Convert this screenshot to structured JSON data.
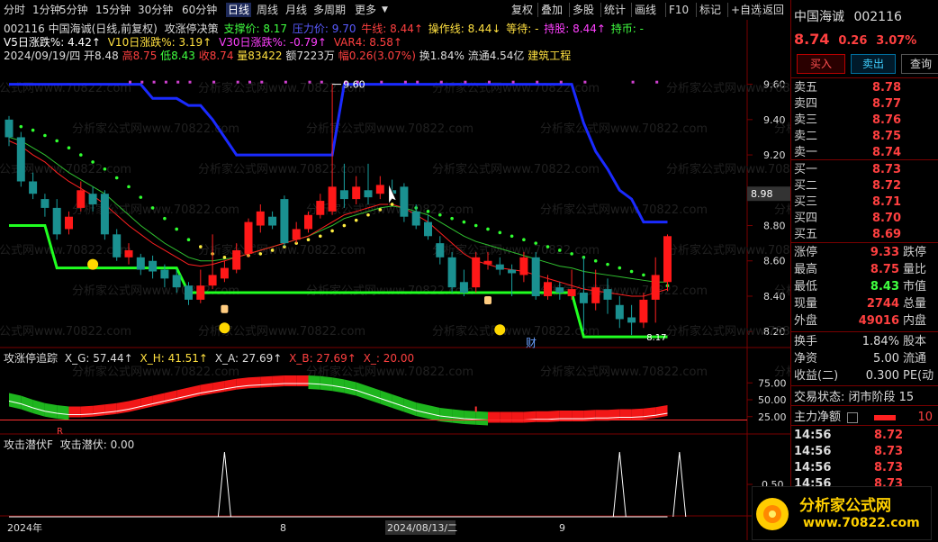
{
  "topbar": {
    "periods": [
      "分时",
      "1分钟",
      "5分钟",
      "15分钟",
      "30分钟",
      "60分钟",
      "日线",
      "周线",
      "月线",
      "多周期",
      "更多"
    ],
    "active_period": "日线",
    "actions": [
      "复权",
      "叠加",
      "多股",
      "统计",
      "画线",
      "F10",
      "标记",
      "+自选",
      "返回"
    ]
  },
  "header": {
    "code_name": "002116 中国海诚(日线,前复权)",
    "indicator_name": "攻涨停决策",
    "support_label": "支撑价: 8.17",
    "pressure_label": "压力价: 9.70",
    "bull_label": "牛线: 8.44↑",
    "op_label": "操作线: 8.44↓",
    "wait_label": "等待: -",
    "hold_label": "持股: 8.44↑",
    "hold_coin_label": "持币: -",
    "v5_label": "V5日涨跌%: 4.42↑",
    "v10_label": "V10日涨跌%: 3.19↑",
    "v30_label": "V30日涨跌%: -0.79↑",
    "var4_label": "VAR4: 8.58↑",
    "info_date": "2024/09/19/四",
    "info_open": "开8.48",
    "info_high": "高8.75",
    "info_low": "低8.43",
    "info_close": "收8.74",
    "info_vol": "量83422",
    "info_amt": "额7223万",
    "info_pct": "幅0.26(3.07%)",
    "info_turn": "换1.84%",
    "info_float": "流通4.54亿",
    "info_sector": "建筑工程"
  },
  "main_axis": {
    "ticks": [
      "9.60",
      "9.40",
      "9.20",
      "9.00",
      "8.80",
      "8.60",
      "8.40",
      "8.20"
    ],
    "current_label": "8.98",
    "max_label": "9.60",
    "min_label": "8.17"
  },
  "sub1": {
    "title": "攻涨停追踪",
    "xg": "X_G: 57.44↑",
    "xh": "X_H: 41.51↑",
    "xa": "X_A: 27.69↑",
    "xb": "X_B: 27.69↑",
    "xx": "X_: 20.00",
    "ticks": [
      "75.00",
      "50.00",
      "25.00"
    ]
  },
  "sub2": {
    "title": "攻击潜伏F",
    "value_label": "攻击潜伏: 0.00",
    "tick": "0.50"
  },
  "xaxis": {
    "labels": [
      "2024年",
      "8",
      "2024/08/13/二",
      "9"
    ]
  },
  "markers": {
    "cai": "财",
    "r_mark": "R"
  },
  "watermark": "分析家公式网www.70822.com",
  "right": {
    "name": "中国海诚",
    "code": "002116",
    "price": "8.74",
    "change": "0.26",
    "pct": "3.07%",
    "buy_btn": "买入",
    "sell_btn": "卖出",
    "query_btn": "查询",
    "asks": [
      {
        "label": "卖五",
        "price": "8.78"
      },
      {
        "label": "卖四",
        "price": "8.77"
      },
      {
        "label": "卖三",
        "price": "8.76"
      },
      {
        "label": "卖二",
        "price": "8.75"
      },
      {
        "label": "卖一",
        "price": "8.74"
      }
    ],
    "bids": [
      {
        "label": "买一",
        "price": "8.73"
      },
      {
        "label": "买二",
        "price": "8.72"
      },
      {
        "label": "买三",
        "price": "8.71"
      },
      {
        "label": "买四",
        "price": "8.70"
      },
      {
        "label": "买五",
        "price": "8.69"
      }
    ],
    "stats": [
      {
        "k": "涨停",
        "v": "9.33",
        "k2": "跌停"
      },
      {
        "k": "最高",
        "v": "8.75",
        "k2": "量比"
      },
      {
        "k": "最低",
        "v": "8.43",
        "k2": "市值"
      },
      {
        "k": "现量",
        "v": "2744",
        "k2": "总量"
      },
      {
        "k": "外盘",
        "v": "49016",
        "k2": "内盘"
      }
    ],
    "stats2": [
      {
        "k": "换手",
        "v": "1.84%",
        "k2": "股本"
      },
      {
        "k": "净资",
        "v": "5.00",
        "k2": "流通"
      },
      {
        "k": "收益(二)",
        "v": "0.300",
        "k2": "PE(动"
      }
    ],
    "trade_state": "交易状态: 闭市阶段 15",
    "main_net": "主力净额",
    "main_net_val": "10",
    "ticks": [
      {
        "t": "14:56",
        "p": "8.72"
      },
      {
        "t": "14:56",
        "p": "8.73"
      },
      {
        "t": "14:56",
        "p": "8.73"
      },
      {
        "t": "14:56",
        "p": "8.73"
      }
    ]
  },
  "logo": {
    "title": "分析家公式网",
    "url": "www.70822.com"
  },
  "chart_data": {
    "type": "candlestick",
    "ylim": [
      8.15,
      9.7
    ],
    "candles": [
      {
        "o": 9.4,
        "c": 9.3,
        "h": 9.42,
        "l": 9.25
      },
      {
        "o": 9.3,
        "c": 9.05,
        "h": 9.33,
        "l": 9.02
      },
      {
        "o": 9.05,
        "c": 8.98,
        "h": 9.1,
        "l": 8.95
      },
      {
        "o": 8.95,
        "c": 8.9,
        "h": 8.98,
        "l": 8.85
      },
      {
        "o": 8.9,
        "c": 8.75,
        "h": 8.95,
        "l": 8.72
      },
      {
        "o": 8.78,
        "c": 8.85,
        "h": 8.88,
        "l": 8.75
      },
      {
        "o": 8.9,
        "c": 9.0,
        "h": 9.05,
        "l": 8.88
      },
      {
        "o": 8.98,
        "c": 8.92,
        "h": 9.02,
        "l": 8.88
      },
      {
        "o": 8.98,
        "c": 8.75,
        "h": 9.0,
        "l": 8.72
      },
      {
        "o": 8.75,
        "c": 8.62,
        "h": 8.78,
        "l": 8.6
      },
      {
        "o": 8.62,
        "c": 8.66,
        "h": 8.7,
        "l": 8.58
      },
      {
        "o": 8.62,
        "c": 8.55,
        "h": 8.64,
        "l": 8.52
      },
      {
        "o": 8.6,
        "c": 8.54,
        "h": 8.63,
        "l": 8.5
      },
      {
        "o": 8.55,
        "c": 8.5,
        "h": 8.58,
        "l": 8.45
      },
      {
        "o": 8.52,
        "c": 8.45,
        "h": 8.55,
        "l": 8.42
      },
      {
        "o": 8.46,
        "c": 8.38,
        "h": 8.48,
        "l": 8.35
      },
      {
        "o": 8.38,
        "c": 8.46,
        "h": 8.55,
        "l": 8.36
      },
      {
        "o": 8.46,
        "c": 8.52,
        "h": 8.75,
        "l": 8.44
      },
      {
        "o": 8.5,
        "c": 8.56,
        "h": 8.6,
        "l": 8.48
      },
      {
        "o": 8.55,
        "c": 8.66,
        "h": 8.7,
        "l": 8.53
      },
      {
        "o": 8.64,
        "c": 8.82,
        "h": 8.84,
        "l": 8.62
      },
      {
        "o": 8.8,
        "c": 8.88,
        "h": 8.92,
        "l": 8.76
      },
      {
        "o": 8.85,
        "c": 8.8,
        "h": 8.88,
        "l": 8.78
      },
      {
        "o": 8.95,
        "c": 8.7,
        "h": 8.97,
        "l": 8.68
      },
      {
        "o": 8.72,
        "c": 8.78,
        "h": 8.82,
        "l": 8.7
      },
      {
        "o": 8.78,
        "c": 8.86,
        "h": 8.88,
        "l": 8.76
      },
      {
        "o": 8.86,
        "c": 8.94,
        "h": 8.98,
        "l": 8.84
      },
      {
        "o": 8.88,
        "c": 9.02,
        "h": 9.6,
        "l": 8.86
      },
      {
        "o": 9.0,
        "c": 8.95,
        "h": 9.15,
        "l": 8.9
      },
      {
        "o": 8.95,
        "c": 9.02,
        "h": 9.08,
        "l": 8.92
      },
      {
        "o": 9.0,
        "c": 8.96,
        "h": 9.15,
        "l": 8.92
      },
      {
        "o": 8.98,
        "c": 9.03,
        "h": 9.08,
        "l": 8.95
      },
      {
        "o": 9.0,
        "c": 8.98,
        "h": 9.06,
        "l": 8.95
      },
      {
        "o": 9.02,
        "c": 8.85,
        "h": 9.04,
        "l": 8.82
      },
      {
        "o": 8.88,
        "c": 8.8,
        "h": 8.92,
        "l": 8.78
      },
      {
        "o": 8.82,
        "c": 8.74,
        "h": 8.86,
        "l": 8.72
      },
      {
        "o": 8.7,
        "c": 8.62,
        "h": 8.74,
        "l": 8.58
      },
      {
        "o": 8.62,
        "c": 8.45,
        "h": 8.65,
        "l": 8.42
      },
      {
        "o": 8.48,
        "c": 8.42,
        "h": 8.55,
        "l": 8.4
      },
      {
        "o": 8.45,
        "c": 8.62,
        "h": 8.65,
        "l": 8.42
      },
      {
        "o": 8.58,
        "c": 8.6,
        "h": 8.65,
        "l": 8.55
      },
      {
        "o": 8.58,
        "c": 8.55,
        "h": 8.62,
        "l": 8.52
      },
      {
        "o": 8.55,
        "c": 8.53,
        "h": 8.58,
        "l": 8.4
      },
      {
        "o": 8.52,
        "c": 8.62,
        "h": 8.65,
        "l": 8.48
      },
      {
        "o": 8.62,
        "c": 8.4,
        "h": 8.65,
        "l": 8.38
      },
      {
        "o": 8.4,
        "c": 8.48,
        "h": 8.52,
        "l": 8.38
      },
      {
        "o": 8.45,
        "c": 8.42,
        "h": 8.48,
        "l": 8.38
      },
      {
        "o": 8.4,
        "c": 8.44,
        "h": 8.55,
        "l": 8.38
      },
      {
        "o": 8.42,
        "c": 8.36,
        "h": 8.62,
        "l": 8.2
      },
      {
        "o": 8.36,
        "c": 8.45,
        "h": 8.55,
        "l": 8.32
      },
      {
        "o": 8.44,
        "c": 8.38,
        "h": 8.5,
        "l": 8.3
      },
      {
        "o": 8.35,
        "c": 8.27,
        "h": 8.4,
        "l": 8.22
      },
      {
        "o": 8.28,
        "c": 8.25,
        "h": 8.35,
        "l": 8.18
      },
      {
        "o": 8.25,
        "c": 8.38,
        "h": 8.42,
        "l": 8.22
      },
      {
        "o": 8.38,
        "c": 8.52,
        "h": 8.62,
        "l": 8.25
      },
      {
        "o": 8.48,
        "c": 8.74,
        "h": 8.75,
        "l": 8.43
      }
    ],
    "support_line": [
      8.8,
      8.8,
      8.8,
      8.8,
      8.56,
      8.56,
      8.56,
      8.56,
      8.56,
      8.56,
      8.56,
      8.56,
      8.56,
      8.56,
      8.56,
      8.42,
      8.42,
      8.42,
      8.42,
      8.42,
      8.42,
      8.42,
      8.42,
      8.42,
      8.42,
      8.42,
      8.42,
      8.42,
      8.42,
      8.42,
      8.42,
      8.42,
      8.42,
      8.42,
      8.42,
      8.42,
      8.42,
      8.42,
      8.42,
      8.42,
      8.42,
      8.42,
      8.42,
      8.42,
      8.42,
      8.42,
      8.42,
      8.42,
      8.17,
      8.17,
      8.17,
      8.17,
      8.17,
      8.17,
      8.17,
      8.17
    ],
    "pressure_line": [
      9.6,
      9.6,
      9.6,
      9.6,
      9.6,
      9.6,
      9.6,
      9.6,
      9.6,
      9.6,
      9.6,
      9.6,
      9.52,
      9.52,
      9.52,
      9.48,
      9.48,
      9.4,
      9.3,
      9.2,
      9.2,
      9.2,
      9.2,
      9.2,
      9.2,
      9.2,
      9.2,
      9.2,
      9.6,
      9.6,
      9.6,
      9.6,
      9.6,
      9.6,
      9.6,
      9.6,
      9.6,
      9.6,
      9.6,
      9.6,
      9.6,
      9.6,
      9.6,
      9.6,
      9.6,
      9.6,
      9.6,
      9.6,
      9.38,
      9.22,
      9.12,
      9.0,
      8.95,
      8.82,
      8.82,
      8.82
    ],
    "ma_red": [
      9.28,
      9.25,
      9.2,
      9.16,
      9.1,
      9.05,
      9.01,
      8.97,
      8.92,
      8.86,
      8.8,
      8.75,
      8.7,
      8.66,
      8.62,
      8.58,
      8.57,
      8.58,
      8.6,
      8.62,
      8.64,
      8.66,
      8.68,
      8.7,
      8.72,
      8.74,
      8.78,
      8.82,
      8.86,
      8.88,
      8.9,
      8.92,
      8.92,
      8.9,
      8.86,
      8.82,
      8.76,
      8.7,
      8.64,
      8.6,
      8.58,
      8.56,
      8.55,
      8.54,
      8.52,
      8.5,
      8.48,
      8.46,
      8.44,
      8.43,
      8.42,
      8.41,
      8.4,
      8.4,
      8.42,
      8.44
    ],
    "ma_green": [
      9.3,
      9.28,
      9.24,
      9.2,
      9.15,
      9.1,
      9.06,
      9.02,
      8.98,
      8.92,
      8.86,
      8.8,
      8.75,
      8.7,
      8.66,
      8.62,
      8.6,
      8.6,
      8.61,
      8.62,
      8.64,
      8.66,
      8.68,
      8.7,
      8.72,
      8.74,
      8.77,
      8.8,
      8.84,
      8.86,
      8.88,
      8.9,
      8.91,
      8.9,
      8.88,
      8.86,
      8.82,
      8.78,
      8.74,
      8.71,
      8.69,
      8.67,
      8.65,
      8.63,
      8.61,
      8.59,
      8.57,
      8.56,
      8.54,
      8.53,
      8.52,
      8.51,
      8.5,
      8.49,
      8.48,
      8.48
    ],
    "dots": [
      9.38,
      9.36,
      9.34,
      9.31,
      9.28,
      9.24,
      9.2,
      9.16,
      9.12,
      9.07,
      9.02,
      8.96,
      8.9,
      8.84,
      8.78,
      8.72,
      8.68,
      8.64,
      8.62,
      8.62,
      8.63,
      8.64,
      8.66,
      8.68,
      8.7,
      8.72,
      8.74,
      8.77,
      8.8,
      8.83,
      8.86,
      8.89,
      8.92,
      8.94,
      8.9,
      8.88,
      8.86,
      8.84,
      8.82,
      8.8,
      8.78,
      8.76,
      8.74,
      8.72,
      8.7,
      8.68,
      8.66,
      8.64,
      8.62,
      8.6,
      8.58,
      8.56,
      8.54,
      8.52,
      8.5,
      8.46
    ],
    "sub1_white": [
      48,
      44,
      38,
      33,
      30,
      28,
      28,
      29,
      31,
      33,
      36,
      40,
      44,
      48,
      52,
      56,
      60,
      63,
      66,
      69,
      71,
      72,
      73,
      74,
      74,
      74,
      73,
      71,
      68,
      64,
      58,
      52,
      46,
      40,
      34,
      30,
      26,
      24,
      22,
      21,
      20,
      20,
      20,
      20,
      21,
      21,
      22,
      22,
      22,
      23,
      23,
      24,
      24,
      25,
      27,
      30
    ]
  }
}
